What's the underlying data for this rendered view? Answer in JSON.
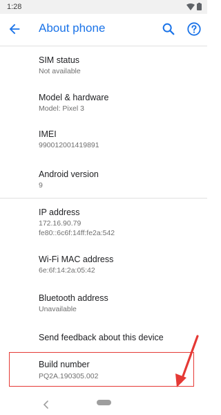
{
  "status_bar": {
    "time": "1:28",
    "icons": [
      "wifi-icon",
      "battery-icon"
    ]
  },
  "app_bar": {
    "title": "About phone",
    "icons": [
      "back-arrow-icon",
      "search-icon",
      "help-icon"
    ]
  },
  "items": [
    {
      "label": "SIM status",
      "value": "Not available"
    },
    {
      "label": "Model & hardware",
      "value": "Model: Pixel 3"
    },
    {
      "label": "IMEI",
      "value": "990012001419891"
    },
    {
      "label": "Android version",
      "value": "9"
    },
    {
      "label": "IP address",
      "value": "172.16.90.79",
      "value2": "fe80::6c6f:14ff:fe2a:542"
    },
    {
      "label": "Wi-Fi MAC address",
      "value": "6e:6f:14:2a:05:42"
    },
    {
      "label": "Bluetooth address",
      "value": "Unavailable"
    },
    {
      "label": "Send feedback about this device"
    },
    {
      "label": "Build number",
      "value": "PQ2A.190305.002"
    }
  ],
  "colors": {
    "accent": "#1a73e8",
    "highlight": "#e53935",
    "text_primary": "#202124",
    "text_secondary": "#6f6f6f"
  },
  "navigation_bar": {
    "icons": [
      "nav-back-icon",
      "nav-home-pill"
    ]
  }
}
